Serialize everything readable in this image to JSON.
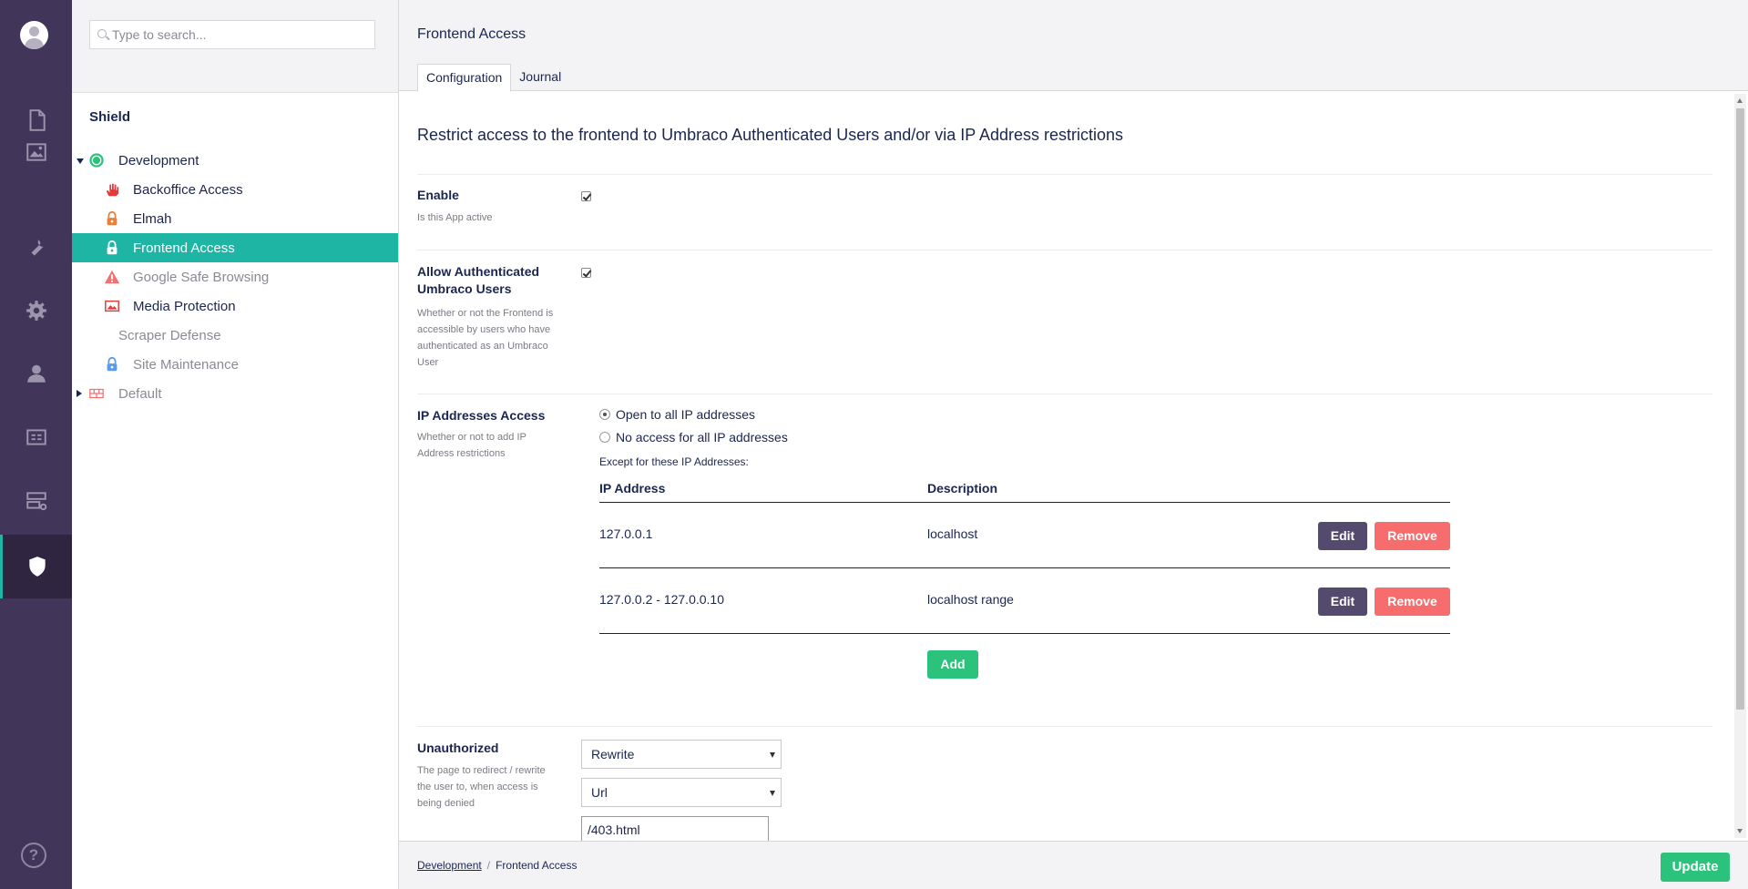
{
  "rail": {
    "items": [
      {
        "name": "content-icon"
      },
      {
        "name": "media-icon"
      },
      {
        "name": "settings-wrench-icon"
      },
      {
        "name": "developer-gear-icon"
      },
      {
        "name": "users-icon"
      },
      {
        "name": "members-icon"
      },
      {
        "name": "forms-icon"
      },
      {
        "name": "shield-icon"
      }
    ],
    "help_label": "?"
  },
  "tree": {
    "search_placeholder": "Type to search...",
    "section_title": "Shield",
    "nodes": [
      {
        "label": "Development",
        "icon": "globe-icon"
      },
      {
        "label": "Backoffice Access",
        "icon": "hand-icon"
      },
      {
        "label": "Elmah",
        "icon": "lock-icon"
      },
      {
        "label": "Frontend Access",
        "icon": "lock-icon"
      },
      {
        "label": "Google Safe Browsing",
        "icon": "warning-icon"
      },
      {
        "label": "Media Protection",
        "icon": "picture-icon"
      },
      {
        "label": "Scraper Defense",
        "icon": ""
      },
      {
        "label": "Site Maintenance",
        "icon": "lock-icon"
      },
      {
        "label": "Default",
        "icon": "firewall-icon"
      }
    ]
  },
  "main": {
    "title": "Frontend Access",
    "tabs": [
      {
        "label": "Configuration"
      },
      {
        "label": "Journal"
      }
    ],
    "lead": "Restrict access to the frontend to Umbraco Authenticated Users and/or via IP Address restrictions",
    "enable": {
      "label": "Enable",
      "desc": "Is this App active",
      "checked": true
    },
    "allow_auth": {
      "label": "Allow Authenticated Umbraco Users",
      "desc": "Whether or not the Frontend is accessible by users who have authenticated as an Umbraco User",
      "checked": true
    },
    "ip_access": {
      "label": "IP Addresses Access",
      "desc": "Whether or not to add IP Address restrictions",
      "options": [
        "Open to all IP addresses",
        "No access for all IP addresses"
      ],
      "selected": "Open to all IP addresses",
      "except_label": "Except for these IP Addresses:",
      "columns": [
        "IP Address",
        "Description"
      ],
      "rows": [
        {
          "ip": "127.0.0.1",
          "description": "localhost"
        },
        {
          "ip": "127.0.0.2 - 127.0.0.10",
          "description": "localhost range"
        }
      ],
      "edit_label": "Edit",
      "remove_label": "Remove",
      "add_label": "Add"
    },
    "unauthorized": {
      "label": "Unauthorized",
      "desc": "The page to redirect / rewrite the user to, when access is being denied",
      "action_value": "Rewrite",
      "type_value": "Url",
      "url_value": "/403.html"
    }
  },
  "footer": {
    "crumbs": [
      "Development",
      "Frontend Access"
    ],
    "separator": "/",
    "update_label": "Update"
  },
  "colors": {
    "rail_bg": "#413659",
    "accent_teal": "#1fb5a5",
    "edit_btn": "#544a6e",
    "remove_btn": "#f76c6c",
    "success_btn": "#2bc37c"
  }
}
